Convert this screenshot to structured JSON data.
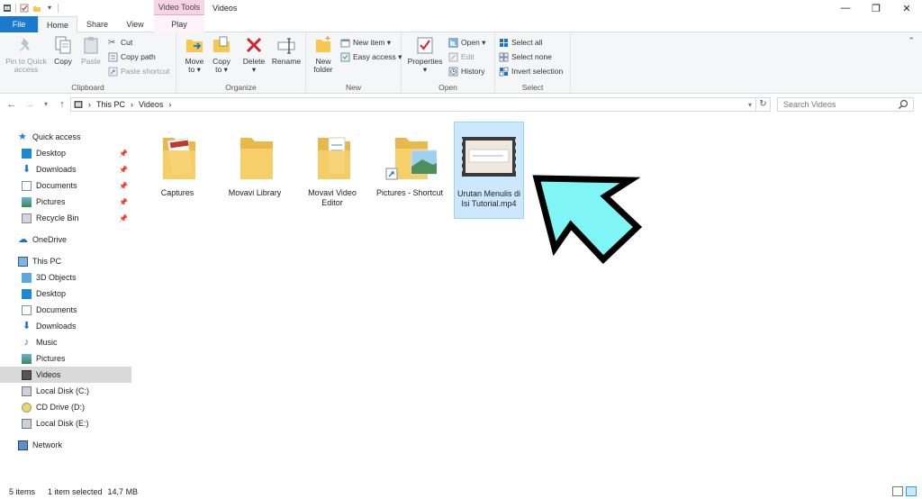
{
  "window": {
    "title": "Videos",
    "context_tab_header": "Video Tools",
    "controls": [
      "—",
      "❐",
      "✕"
    ]
  },
  "ribbon_tabs": {
    "file": "File",
    "home": "Home",
    "share": "Share",
    "view": "View",
    "play": "Play"
  },
  "ribbon": {
    "clipboard": {
      "label": "Clipboard",
      "pin": "Pin to Quick access",
      "copy": "Copy",
      "paste": "Paste",
      "cut": "Cut",
      "copy_path": "Copy path",
      "paste_shortcut": "Paste shortcut"
    },
    "organize": {
      "label": "Organize",
      "move_to": "Move to ▾",
      "copy_to": "Copy to ▾",
      "delete": "Delete ▾",
      "rename": "Rename"
    },
    "new": {
      "label": "New",
      "new_folder": "New folder",
      "new_item": "New item ▾",
      "easy_access": "Easy access ▾"
    },
    "open": {
      "label": "Open",
      "properties": "Properties ▾",
      "open": "Open ▾",
      "edit": "Edit",
      "history": "History"
    },
    "select": {
      "label": "Select",
      "select_all": "Select all",
      "select_none": "Select none",
      "invert_selection": "Invert selection"
    }
  },
  "address": {
    "back": "←",
    "forward": "→",
    "up": "↑",
    "crumbs": [
      "This PC",
      "›",
      "Videos",
      "›"
    ],
    "search_placeholder": "Search Videos"
  },
  "nav": {
    "quick_access": "Quick access",
    "qa_items": [
      "Desktop",
      "Downloads",
      "Documents",
      "Pictures",
      "Recycle Bin"
    ],
    "onedrive": "OneDrive",
    "this_pc": "This PC",
    "pc_items": [
      "3D Objects",
      "Desktop",
      "Documents",
      "Downloads",
      "Music",
      "Pictures",
      "Videos",
      "Local Disk (C:)",
      "CD Drive (D:)",
      "Local Disk (E:)"
    ],
    "network": "Network"
  },
  "files": [
    {
      "name": "Captures"
    },
    {
      "name": "Movavi Library"
    },
    {
      "name": "Movavi Video Editor"
    },
    {
      "name": "Pictures - Shortcut"
    },
    {
      "name": "Urutan Menulis di Isi Tutorial.mp4"
    }
  ],
  "status": {
    "count": "5 items",
    "selected": "1 item selected",
    "size": "14,7 MB"
  },
  "colors": {
    "file_tab": "#1979ca",
    "context_tab": "#f7d3e6",
    "selection": "#cce8ff",
    "arrow_fill": "#7ff5f5"
  }
}
